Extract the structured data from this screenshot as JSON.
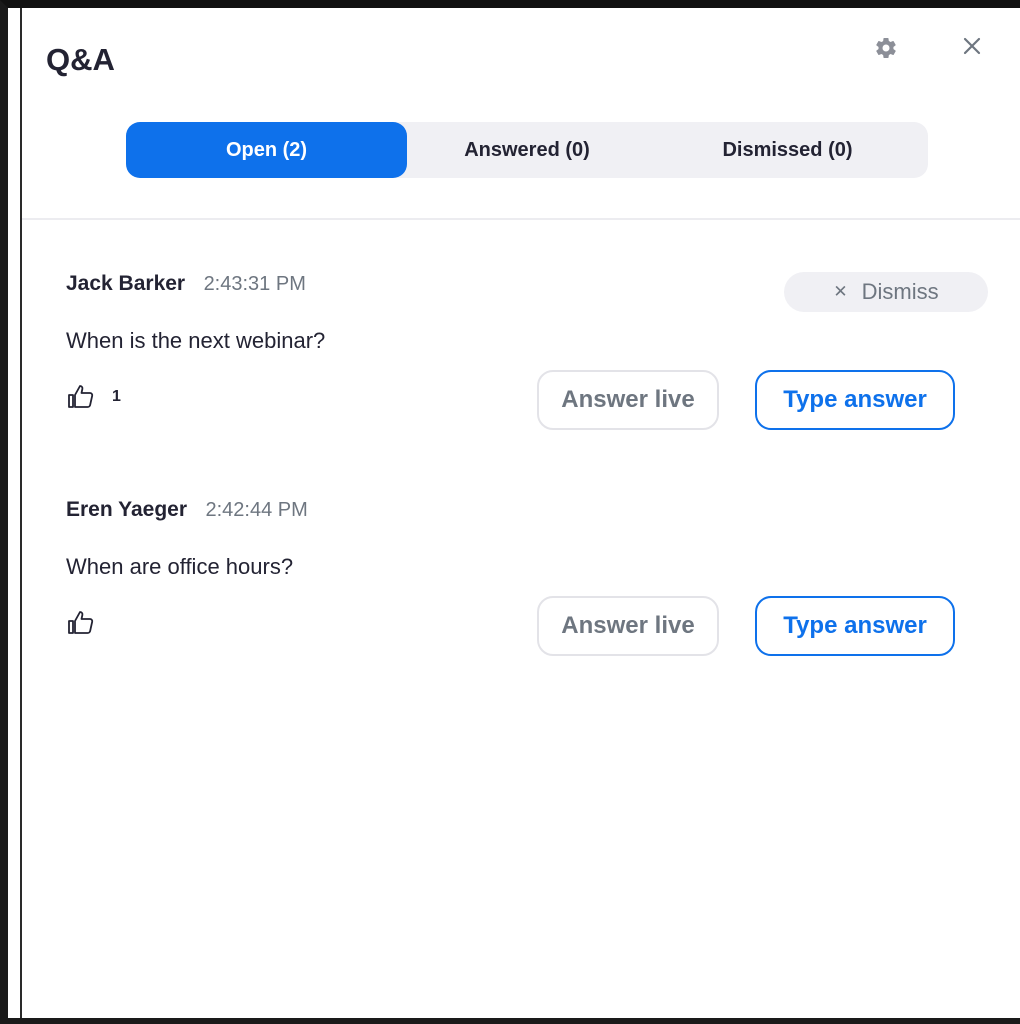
{
  "panel": {
    "title": "Q&A",
    "settings_icon": "gear-icon",
    "close_icon": "close-icon"
  },
  "tabs": [
    {
      "label": "Open (2)",
      "active": true
    },
    {
      "label": "Answered (0)",
      "active": false
    },
    {
      "label": "Dismissed (0)",
      "active": false
    }
  ],
  "questions": [
    {
      "name": "Jack Barker",
      "time": "2:43:31 PM",
      "text": "When is the next webinar?",
      "likes": "1",
      "dismiss_label": "Dismiss",
      "answer_live_label": "Answer live",
      "type_answer_label": "Type answer"
    },
    {
      "name": "Eren Yaeger",
      "time": "2:42:44 PM",
      "text": "When are office hours?",
      "likes": "",
      "answer_live_label": "Answer live",
      "type_answer_label": "Type answer"
    }
  ],
  "colors": {
    "accent": "#0e71eb",
    "text": "#232333",
    "muted": "#6e7680",
    "tab_bg": "#f0f0f4"
  }
}
